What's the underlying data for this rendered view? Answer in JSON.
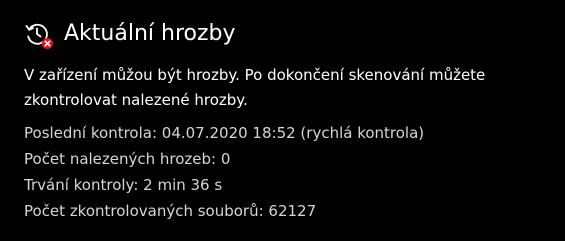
{
  "header": {
    "icon": "history-clock-icon",
    "badge_icon": "close-icon",
    "title": "Aktuální hrozby"
  },
  "description": "V zařízení můžou být hrozby. Po dokončení skenování můžete zkontrolovat nalezené hrozby.",
  "details": [
    {
      "text": "Poslední kontrola: 04.07.2020 18:52 (rychlá kontrola)"
    },
    {
      "text": "Počet nalezených hrozeb: 0"
    },
    {
      "text": "Trvání kontroly: 2 min 36 s"
    },
    {
      "text": "Počet zkontrolovaných souborů: 62127"
    }
  ],
  "colors": {
    "background": "#000000",
    "text": "#ffffff",
    "secondary_text": "#d6d6d6",
    "alert": "#e81123"
  }
}
